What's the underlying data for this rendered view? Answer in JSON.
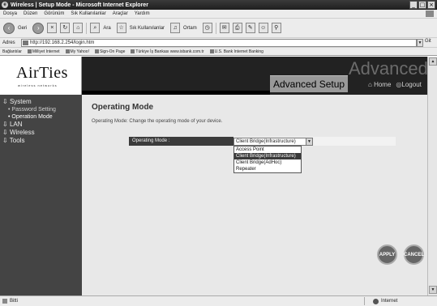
{
  "window": {
    "title": "Wireless | Setup Mode - Microsoft Internet Explorer",
    "controls": [
      "_",
      "□",
      "×"
    ]
  },
  "menubar": [
    "Dosya",
    "Düzen",
    "Görünüm",
    "Sık Kullanılanlar",
    "Araçlar",
    "Yardım"
  ],
  "toolbar": {
    "back_label": "Geri",
    "search_label": "Ara",
    "favorites_label": "Sık Kullanılanlar",
    "media_label": "Ortam"
  },
  "addressbar": {
    "label": "Adres",
    "url": "http://192.168.2.254/login.htm",
    "go_label": "Git"
  },
  "linksbar": {
    "label": "Bağlantılar",
    "links": [
      "Milliyet Internet",
      "My Yahoo!",
      "Sign-On Page",
      "Türkiye İş Bankası www.isbank.com.tr",
      "U.S. Bank Internet Banking"
    ]
  },
  "header": {
    "logo": "AirTies",
    "logo_sub": "wireless networks",
    "big_text": "Advanced Setup",
    "title": "Advanced Setup",
    "home_link": "Home",
    "logout_link": "Logout"
  },
  "sidebar": {
    "items": [
      {
        "label": "System",
        "children": [
          "Password Setting",
          "Operation Mode"
        ]
      },
      {
        "label": "LAN",
        "children": []
      },
      {
        "label": "Wireless",
        "children": []
      },
      {
        "label": "Tools",
        "children": []
      }
    ]
  },
  "content": {
    "title": "Operating Mode",
    "description": "Operating Mode: Change the operating mode of your device.",
    "field_label": "Operating Mode :",
    "selected_value": "Client Bridge(Infrastructure)",
    "options": [
      "Access Point",
      "Client Bridge(Infrastructure)",
      "Client Bridge(AdHoc)",
      "Repeater"
    ],
    "highlighted_option": "Client Bridge(Infrastructure)",
    "apply_label": "APPLY",
    "cancel_label": "CANCEL"
  },
  "statusbar": {
    "left_text": "Bitti",
    "zone_text": "Internet"
  }
}
